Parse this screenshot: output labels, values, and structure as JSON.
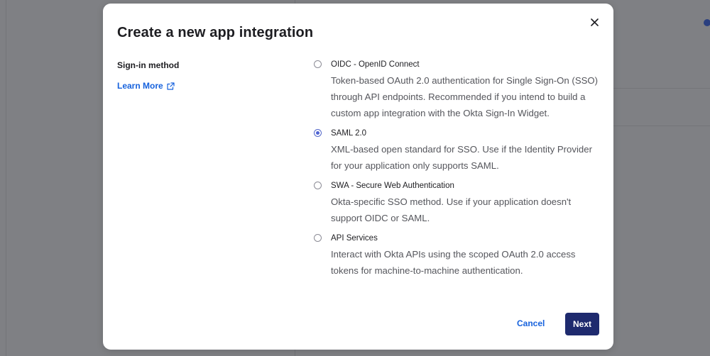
{
  "modal": {
    "title": "Create a new app integration",
    "close_icon": "close-icon"
  },
  "sign_in": {
    "label": "Sign-in method",
    "learn_more": "Learn More",
    "learn_more_icon": "external-link-icon"
  },
  "options": [
    {
      "title": "OIDC - OpenID Connect",
      "description": "Token-based OAuth 2.0 authentication for Single Sign-On (SSO) through API endpoints. Recommended if you intend to build a custom app integration with the Okta Sign-In Widget.",
      "selected": false
    },
    {
      "title": "SAML 2.0",
      "description": "XML-based open standard for SSO. Use if the Identity Provider for your application only supports SAML.",
      "selected": true
    },
    {
      "title": "SWA - Secure Web Authentication",
      "description": "Okta-specific SSO method. Use if your application doesn't support OIDC or SAML.",
      "selected": false
    },
    {
      "title": "API Services",
      "description": "Interact with Okta APIs using the scoped OAuth 2.0 access tokens for machine-to-machine authentication.",
      "selected": false
    }
  ],
  "footer": {
    "cancel_label": "Cancel",
    "next_label": "Next"
  },
  "colors": {
    "accent": "#1662dd",
    "primary_button": "#1e2a6e",
    "radio_selected": "#4f64d4"
  }
}
